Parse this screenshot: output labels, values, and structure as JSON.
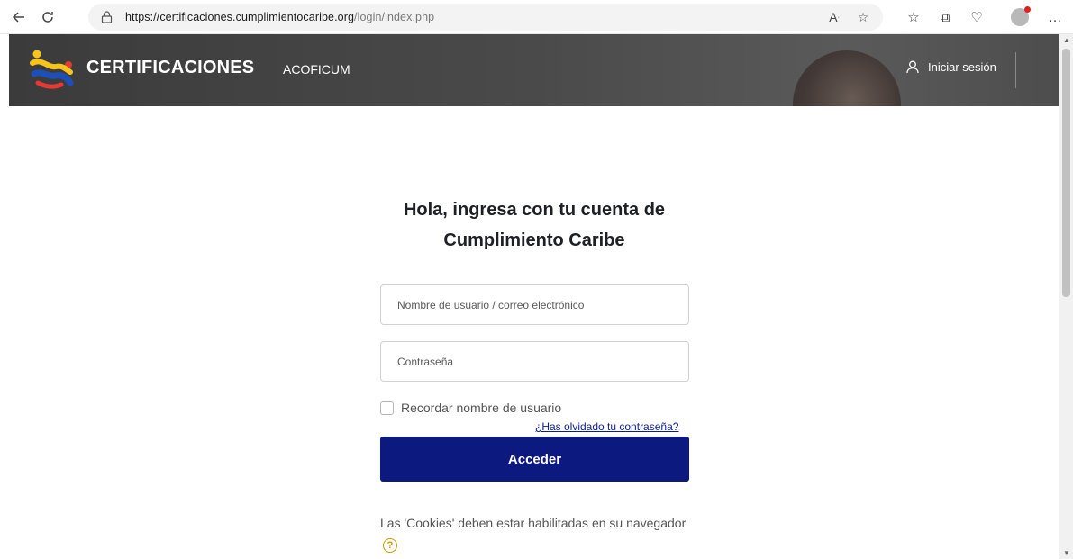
{
  "browser": {
    "url_host": "https://certificaciones.cumplimientocaribe.org",
    "url_path": "/login/index.php"
  },
  "header": {
    "brand": "CERTIFICACIONES",
    "nav_link": "ACOFICUM",
    "login_label": "Iniciar sesión"
  },
  "login": {
    "title_line1": "Hola, ingresa con tu cuenta de",
    "title_line2": "Cumplimiento Caribe",
    "username_placeholder": "Nombre de usuario / correo electrónico",
    "password_placeholder": "Contraseña",
    "remember_label": "Recordar nombre de usuario",
    "forgot_link": "¿Has olvidado tu contraseña?",
    "submit_label": "Acceder",
    "cookies_note": "Las 'Cookies' deben estar habilitadas en su navegador"
  },
  "colors": {
    "header_bg": "#404040",
    "primary_button": "#0c1a80",
    "link": "#0a1f8f"
  }
}
